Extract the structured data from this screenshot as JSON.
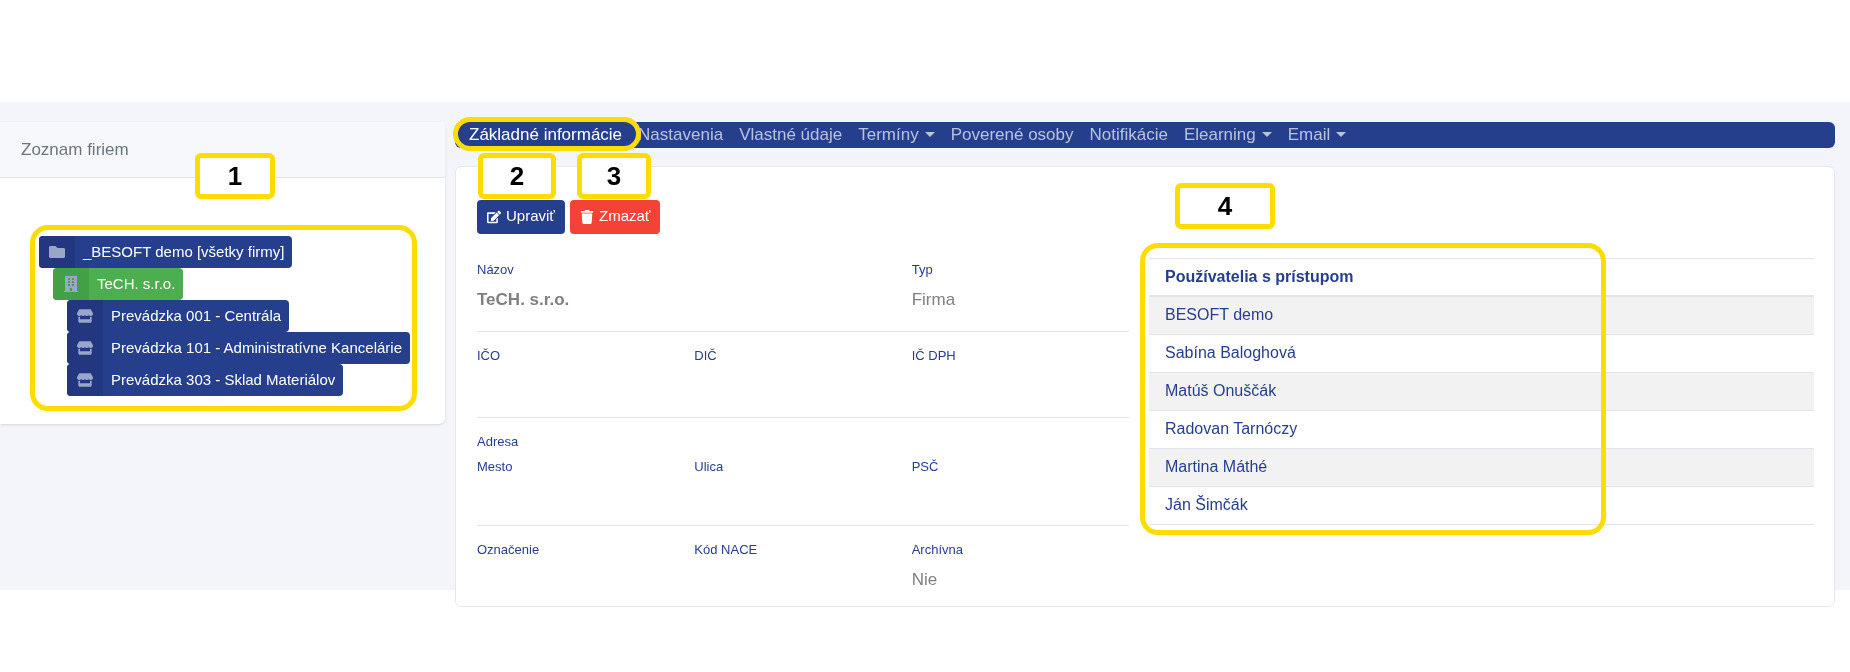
{
  "sidebar": {
    "title": "Zoznam firiem",
    "tree": [
      {
        "label": "_BESOFT demo [všetky firmy]",
        "kind": "folder",
        "selected": false,
        "children": [
          {
            "label": "TeCH. s.r.o.",
            "kind": "building",
            "selected": true,
            "children": [
              {
                "label": "Prevádzka 001 - Centrála",
                "kind": "store",
                "selected": false
              },
              {
                "label": "Prevádzka 101 - Administratívne Kancelárie",
                "kind": "store",
                "selected": false
              },
              {
                "label": "Prevádzka 303 - Sklad Materiálov",
                "kind": "store",
                "selected": false
              }
            ]
          }
        ]
      }
    ]
  },
  "tabs": [
    {
      "label": "Základné informácie",
      "selected": true,
      "dropdown": false
    },
    {
      "label": "Nastavenia",
      "selected": false,
      "dropdown": false
    },
    {
      "label": "Vlastné údaje",
      "selected": false,
      "dropdown": false
    },
    {
      "label": "Termíny",
      "selected": false,
      "dropdown": true
    },
    {
      "label": "Poverené osoby",
      "selected": false,
      "dropdown": false
    },
    {
      "label": "Notifikácie",
      "selected": false,
      "dropdown": false
    },
    {
      "label": "Elearning",
      "selected": false,
      "dropdown": true
    },
    {
      "label": "Email",
      "selected": false,
      "dropdown": true
    }
  ],
  "buttons": [
    {
      "label": "Upraviť",
      "kind": "edit"
    },
    {
      "label": "Zmazať",
      "kind": "delete"
    }
  ],
  "field_rows": [
    {
      "fields": [
        {
          "label": "Názov",
          "value": "TeCH. s.r.o.",
          "bold": true
        },
        {
          "label": "Typ",
          "value": "Firma",
          "bold": false
        }
      ]
    },
    {
      "fields": [
        {
          "label": "IČO"
        },
        {
          "label": "DIČ"
        },
        {
          "label": "IČ DPH"
        }
      ]
    },
    {
      "group": "Adresa",
      "fields": [
        {
          "label": "Mesto"
        },
        {
          "label": "Ulica"
        },
        {
          "label": "PSČ"
        }
      ]
    },
    {
      "fields": [
        {
          "label": "Označenie"
        },
        {
          "label": "Kód NACE"
        },
        {
          "label": "Archívna",
          "value": "Nie",
          "bold": false
        }
      ]
    }
  ],
  "users_table": {
    "header": "Používatelia s prístupom",
    "rows": [
      "BESOFT demo",
      "Sabína Baloghová",
      "Matúš Onuščák",
      "Radovan Tarnóczy",
      "Martina Máthé",
      "Ján Šimčák"
    ]
  },
  "annotations": [
    {
      "number": "1"
    },
    {
      "number": "2"
    },
    {
      "number": "3"
    },
    {
      "number": "4"
    }
  ]
}
